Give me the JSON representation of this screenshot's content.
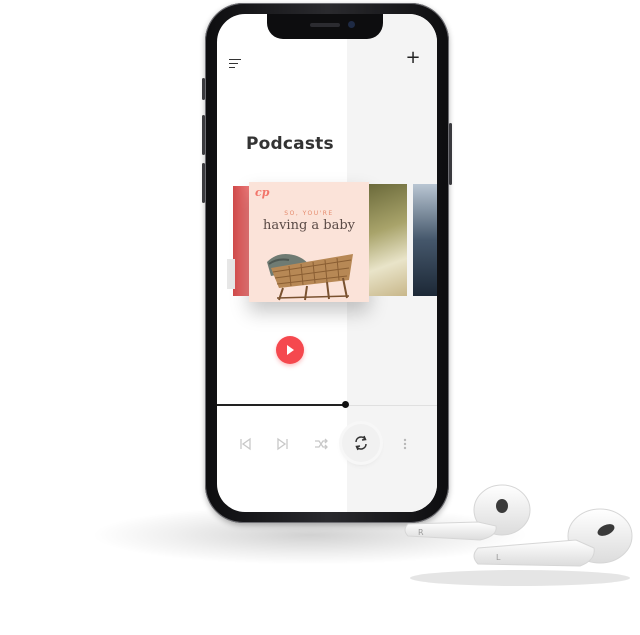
{
  "screen": {
    "title": "Podcasts",
    "menu_icon": "menu-icon",
    "add_icon": "plus-icon",
    "add_glyph": "+"
  },
  "carousel": {
    "featured": {
      "logo": "cp",
      "kicker": "SO, YOU'RE",
      "title": "having a baby",
      "art_icon": "bassinet-illustration"
    }
  },
  "player": {
    "play_icon": "play-icon",
    "progress": 0.58,
    "controls": [
      {
        "name": "previous-icon"
      },
      {
        "name": "next-icon"
      },
      {
        "name": "shuffle-icon"
      },
      {
        "name": "repeat-icon"
      },
      {
        "name": "more-vertical-icon"
      }
    ]
  },
  "accessories": {
    "left_bud_letter": "R",
    "right_bud_letter": "L"
  },
  "colors": {
    "accent": "#f5484e",
    "album_bg": "#fbe3d9",
    "panel_bg": "#f4f4f4"
  }
}
